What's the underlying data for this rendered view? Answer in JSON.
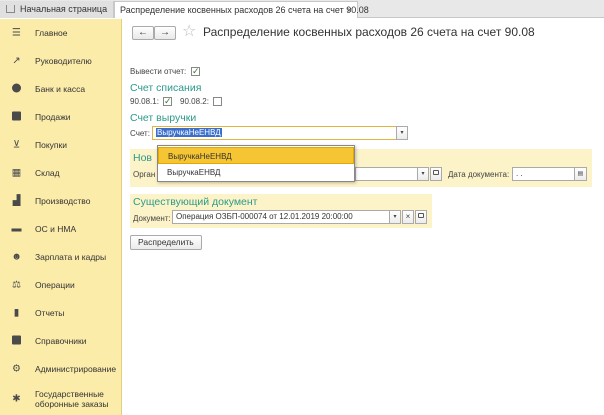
{
  "tabs": {
    "home": "Начальная страница",
    "active": "Распределение косвенных расходов 26 счета на счет 90.08",
    "close": "×"
  },
  "sidebar": {
    "items": [
      {
        "label": "Главное",
        "icon": "menu-icon"
      },
      {
        "label": "Руководителю",
        "icon": "trend-icon"
      },
      {
        "label": "Банк и касса",
        "icon": "coin-icon"
      },
      {
        "label": "Продажи",
        "icon": "bag-icon"
      },
      {
        "label": "Покупки",
        "icon": "cart-icon"
      },
      {
        "label": "Склад",
        "icon": "warehouse-icon"
      },
      {
        "label": "Производство",
        "icon": "factory-icon"
      },
      {
        "label": "ОС и НМА",
        "icon": "truck-icon"
      },
      {
        "label": "Зарплата и кадры",
        "icon": "people-icon"
      },
      {
        "label": "Операции",
        "icon": "operations-icon"
      },
      {
        "label": "Отчеты",
        "icon": "chart-icon"
      },
      {
        "label": "Справочники",
        "icon": "book-icon"
      },
      {
        "label": "Администрирование",
        "icon": "gear-icon"
      },
      {
        "label": "Государственные оборонные заказы",
        "icon": "defense-icon"
      }
    ]
  },
  "header": {
    "back": "←",
    "forward": "→",
    "star": "☆",
    "title": "Распределение косвенных расходов 26 счета на счет 90.08"
  },
  "form": {
    "report_label": "Вывести отчет:",
    "report_checked": "✓",
    "writeoff_title": "Счет списания",
    "acc1_label": "90.08.1:",
    "acc1_checked": "✓",
    "acc2_label": "90.08.2:",
    "acc2_checked": "",
    "revenue_title": "Счет выручки",
    "account_label": "Счет:",
    "account_value": "ВыручкаНеЕНВД",
    "new_doc_title": "Нов",
    "org_label": "Орган",
    "date_label": "Дата документа:",
    "date_value": ". .",
    "existing_title": "Существующий документ",
    "document_label": "Документ:",
    "document_value": "Операция ОЗБП-000074 от 12.01.2019 20:00:00",
    "distribute_button": "Распределить"
  },
  "dropdown": {
    "options": [
      "ВыручкаНеЕНВД",
      "ВыручкаЕНВД"
    ],
    "selected": "ВыручкаНеЕНВД"
  },
  "colors": {
    "sidebar_bg": "#fbecaa",
    "section_title": "#2a9a8a",
    "dropdown_highlight": "#f6c533",
    "selection": "#3c6fcb"
  }
}
